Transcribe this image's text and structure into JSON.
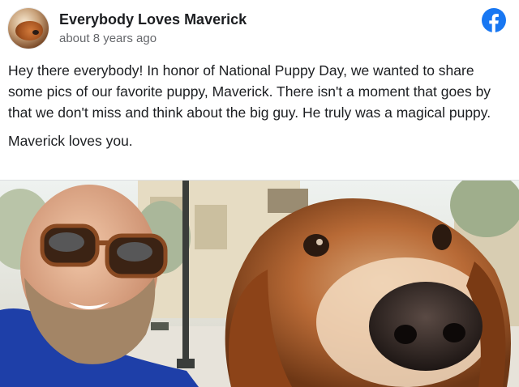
{
  "post": {
    "author": "Everybody Loves Maverick",
    "timestamp": "about 8 years ago",
    "paragraphs": [
      "Hey there everybody! In honor of National Puppy Day, we wanted to share some pics of our favorite puppy, Maverick. There isn't a moment that goes by that we don't miss and think about the big guy. He truly was a magical puppy.",
      "Maverick loves you."
    ]
  },
  "icons": {
    "platform": "facebook-icon",
    "avatar": "dog-avatar"
  },
  "colors": {
    "facebook_blue": "#1877f2",
    "timestamp_gray": "#65676b",
    "text": "#1c1e21"
  }
}
